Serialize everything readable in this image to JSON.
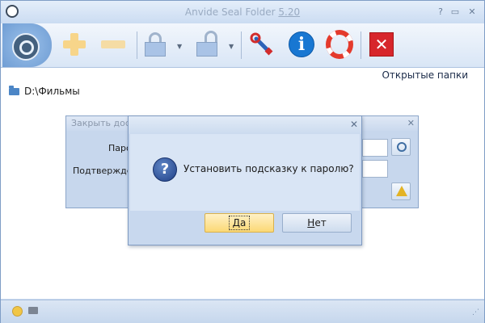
{
  "window": {
    "title": "Anvide Seal Folder",
    "version": "5.20",
    "controls": {
      "help": "?",
      "minimize": "▭",
      "maximize": "▢",
      "close": "✕"
    }
  },
  "toolbar": {
    "items": [
      {
        "name": "main-lock",
        "icon": "lock-icon"
      },
      {
        "name": "add-folder",
        "icon": "plus-icon"
      },
      {
        "name": "remove-folder",
        "icon": "minus-icon"
      },
      {
        "name": "close-access",
        "icon": "padlock-closed-icon"
      },
      {
        "name": "open-access",
        "icon": "padlock-open-icon"
      },
      {
        "name": "settings",
        "icon": "wrench-icon"
      },
      {
        "name": "info",
        "icon": "info-icon"
      },
      {
        "name": "help",
        "icon": "lifebuoy-icon"
      },
      {
        "name": "exit",
        "icon": "close-x-icon"
      }
    ],
    "dropdown_arrow": "▼"
  },
  "content": {
    "open_folders_link": "Открытые папки",
    "folders": [
      "D:\\Фильмы"
    ]
  },
  "background_dialog": {
    "title": "Закрыть дос",
    "close": "✕",
    "password_label": "Паро",
    "confirm_label": "Подтвержден"
  },
  "message_box": {
    "close": "✕",
    "icon_glyph": "?",
    "text": "Установить подсказку к паролю?",
    "yes": {
      "mnemonic": "Д",
      "rest": "а"
    },
    "no": {
      "mnemonic": "Н",
      "rest": "ет"
    }
  },
  "status_bar": {
    "grip": "⋰"
  },
  "colors": {
    "accent": "#1877d2",
    "danger": "#d7262b",
    "default_button": "#fbd875"
  }
}
